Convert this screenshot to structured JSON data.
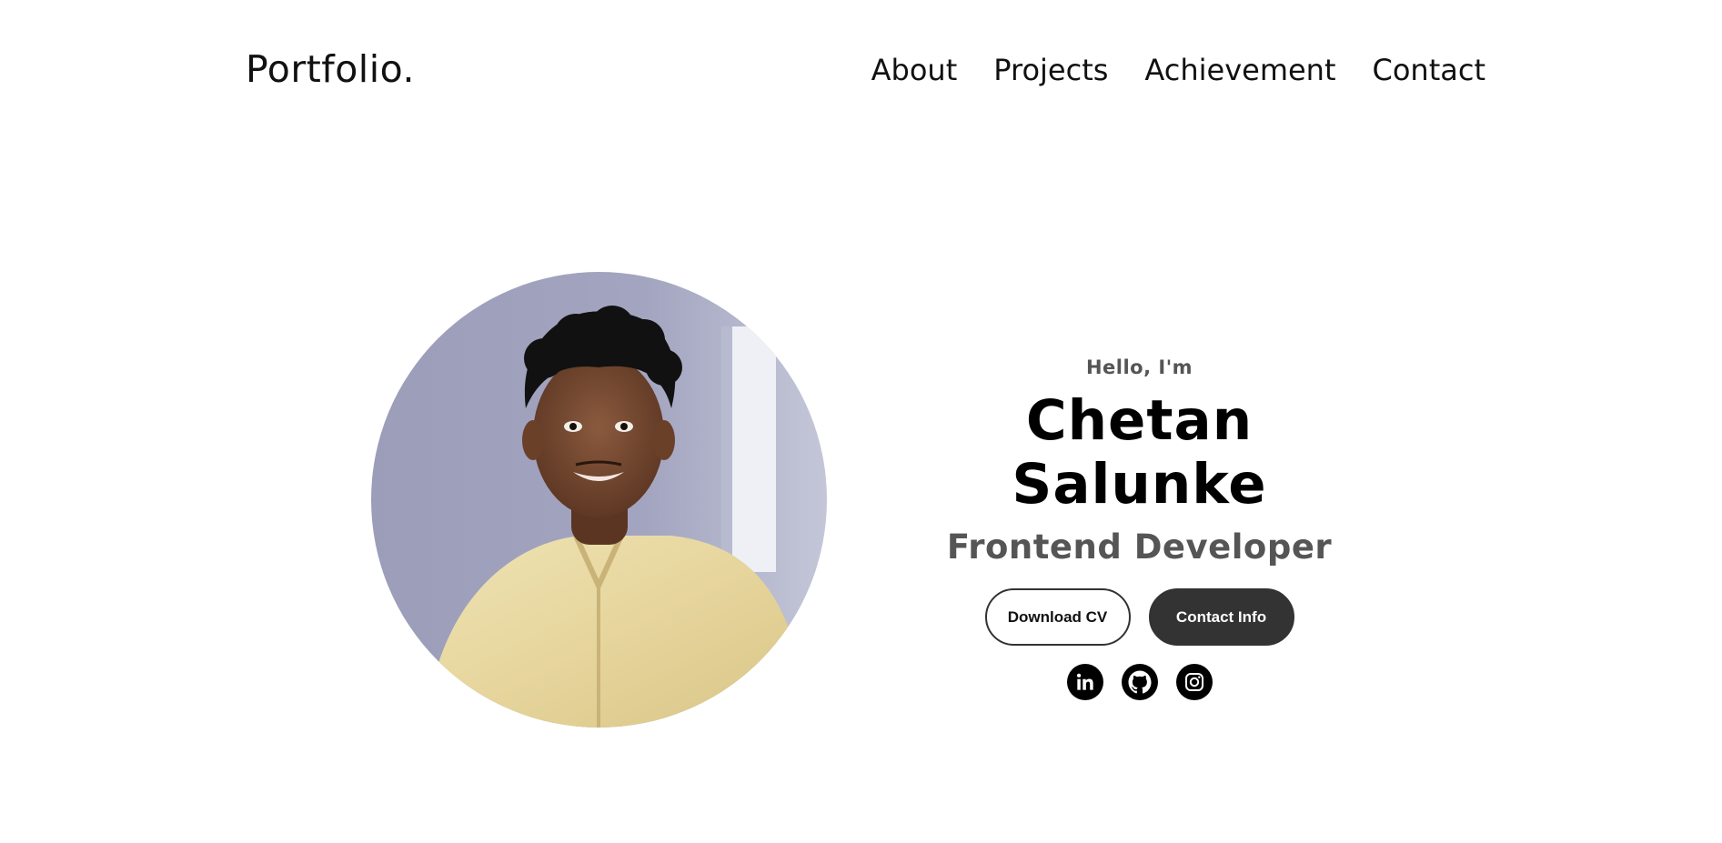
{
  "nav": {
    "logo": "Portfolio.",
    "links": [
      {
        "label": "About"
      },
      {
        "label": "Projects"
      },
      {
        "label": "Achievement"
      },
      {
        "label": "Contact"
      }
    ]
  },
  "hero": {
    "greeting": "Hello, I'm",
    "name": "Chetan Salunke",
    "role": "Frontend Developer",
    "buttons": {
      "download_cv": "Download CV",
      "contact_info": "Contact Info"
    },
    "socials": [
      {
        "icon": "linkedin-icon"
      },
      {
        "icon": "github-icon"
      },
      {
        "icon": "instagram-icon"
      }
    ]
  },
  "colors": {
    "text": "#000000",
    "muted_text": "#555555",
    "button_dark": "#333333",
    "background": "#ffffff"
  }
}
